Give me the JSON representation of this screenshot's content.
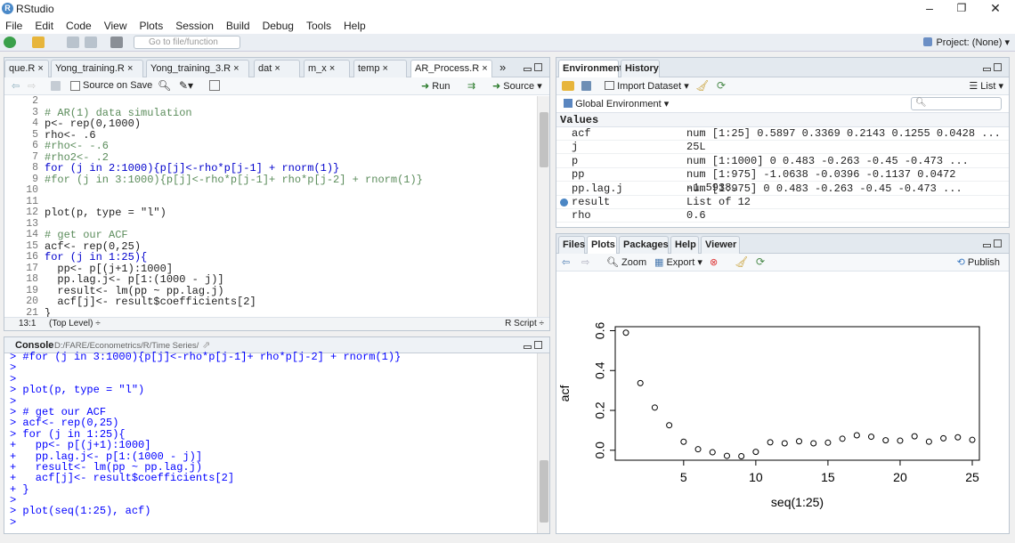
{
  "window": {
    "title": "RStudio"
  },
  "menu": [
    "File",
    "Edit",
    "Code",
    "View",
    "Plots",
    "Session",
    "Build",
    "Debug",
    "Tools",
    "Help"
  ],
  "toolbar": {
    "goto_placeholder": "Go to file/function",
    "project": "Project: (None)"
  },
  "editor": {
    "tabs": [
      "que.R",
      "Yong_training.R",
      "Yong_training_3.R",
      "dat",
      "m_x",
      "temp",
      "AR_Process.R"
    ],
    "source_on_save": "Source on Save",
    "run": "Run",
    "source": "Source",
    "lines": [
      {
        "n": "2",
        "t": ""
      },
      {
        "n": "3",
        "t": "# AR(1) data simulation",
        "c": "cm"
      },
      {
        "n": "4",
        "t": "p<- rep(0,1000)"
      },
      {
        "n": "5",
        "t": "rho<- .6"
      },
      {
        "n": "6",
        "t": "#rho<- -.6",
        "c": "cm"
      },
      {
        "n": "7",
        "t": "#rho2<- .2",
        "c": "cm"
      },
      {
        "n": "8",
        "t": "for (j in 2:1000){p[j]<-rho*p[j-1] + rnorm(1)}",
        "c": "kw1"
      },
      {
        "n": "9",
        "t": "#for (j in 3:1000){p[j]<-rho*p[j-1]+ rho*p[j-2] + rnorm(1)}",
        "c": "cm"
      },
      {
        "n": "10",
        "t": ""
      },
      {
        "n": "11",
        "t": ""
      },
      {
        "n": "12",
        "t": "plot(p, type = \"l\")"
      },
      {
        "n": "13",
        "t": ""
      },
      {
        "n": "14",
        "t": "# get our ACF",
        "c": "cm"
      },
      {
        "n": "15",
        "t": "acf<- rep(0,25)"
      },
      {
        "n": "16",
        "t": "for (j in 1:25){",
        "c": "kw1"
      },
      {
        "n": "17",
        "t": "  pp<- p[(j+1):1000]"
      },
      {
        "n": "18",
        "t": "  pp.lag.j<- p[1:(1000 - j)]"
      },
      {
        "n": "19",
        "t": "  result<- lm(pp ~ pp.lag.j)"
      },
      {
        "n": "20",
        "t": "  acf[j]<- result$coefficients[2]"
      },
      {
        "n": "21",
        "t": "}"
      }
    ],
    "status_pos": "13:1",
    "status_level": "(Top Level)",
    "status_type": "R Script"
  },
  "console": {
    "title": "Console",
    "path": "D:/FARE/Econometrics/R/Time Series/",
    "lines": [
      "> #for (j in 3:1000){p[j]<-rho*p[j-1]+ rho*p[j-2] + rnorm(1)}",
      ">",
      ">",
      "> plot(p, type = \"l\")",
      ">",
      "> # get our ACF",
      "> acf<- rep(0,25)",
      "> for (j in 1:25){",
      "+   pp<- p[(j+1):1000]",
      "+   pp.lag.j<- p[1:(1000 - j)]",
      "+   result<- lm(pp ~ pp.lag.j)",
      "+   acf[j]<- result$coefficients[2]",
      "+ }",
      ">",
      "> plot(seq(1:25), acf)",
      "> "
    ]
  },
  "environment": {
    "tabs": [
      "Environment",
      "History"
    ],
    "import": "Import Dataset",
    "list": "List",
    "scope": "Global Environment",
    "section": "Values",
    "rows": [
      {
        "name": "acf",
        "value": "num [1:25] 0.5897 0.3369 0.2143 0.1255 0.0428 ..."
      },
      {
        "name": "j",
        "value": "25L"
      },
      {
        "name": "p",
        "value": "num [1:1000] 0 0.483 -0.263 -0.45 -0.473 ..."
      },
      {
        "name": "pp",
        "value": "num [1:975] -1.0638 -0.0396 -0.1137 0.0472 -1.5938…"
      },
      {
        "name": "pp.lag.j",
        "value": "num [1:975] 0 0.483 -0.263 -0.45 -0.473 ..."
      },
      {
        "name": "result",
        "value": "List of 12"
      },
      {
        "name": "rho",
        "value": "0.6"
      }
    ]
  },
  "files": {
    "tabs": [
      "Files",
      "Plots",
      "Packages",
      "Help",
      "Viewer"
    ],
    "zoom": "Zoom",
    "export": "Export",
    "publish": "Publish"
  },
  "chart_data": {
    "type": "scatter",
    "title": "",
    "xlabel": "seq(1:25)",
    "ylabel": "acf",
    "xlim": [
      1,
      25
    ],
    "ylim": [
      -0.05,
      0.62
    ],
    "xticks": [
      5,
      10,
      15,
      20,
      25
    ],
    "yticks": [
      0.0,
      0.2,
      0.4,
      0.6
    ],
    "x": [
      1,
      2,
      3,
      4,
      5,
      6,
      7,
      8,
      9,
      10,
      11,
      12,
      13,
      14,
      15,
      16,
      17,
      18,
      19,
      20,
      21,
      22,
      23,
      24,
      25
    ],
    "y": [
      0.5897,
      0.3369,
      0.2143,
      0.1255,
      0.0428,
      0.005,
      -0.01,
      -0.028,
      -0.03,
      -0.008,
      0.04,
      0.035,
      0.045,
      0.035,
      0.038,
      0.058,
      0.075,
      0.068,
      0.05,
      0.048,
      0.07,
      0.043,
      0.06,
      0.065,
      0.052
    ]
  }
}
